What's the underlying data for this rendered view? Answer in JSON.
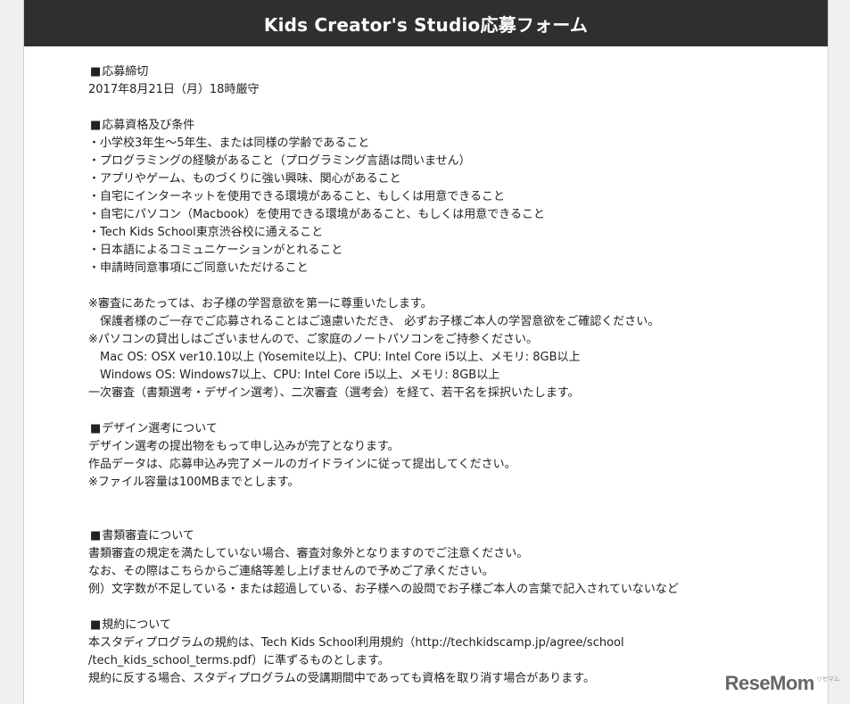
{
  "page": {
    "title": "Kids Creator's Studio応募フォーム"
  },
  "deadline": {
    "heading": "応募締切",
    "lines": [
      "2017年8月21日（月）18時厳守"
    ]
  },
  "eligibility": {
    "heading": "応募資格及び条件",
    "lines": [
      "・小学校3年生〜5年生、または同様の学齢であること",
      "・プログラミングの経験があること（プログラミング言語は問いません）",
      "・アプリやゲーム、ものづくりに強い興味、関心があること",
      "・自宅にインターネットを使用できる環境があること、もしくは用意できること",
      "・自宅にパソコン（Macbook）を使用できる環境があること、もしくは用意できること",
      "・Tech Kids School東京渋谷校に通えること",
      "・日本語によるコミュニケーションがとれること",
      "・申請時同意事項にご同意いただけること"
    ]
  },
  "notes": {
    "lines": [
      "※審査にあたっては、お子様の学習意欲を第一に尊重いたします。",
      "　保護者様のご一存でご応募されることはご遠慮いただき、 必ずお子様ご本人の学習意欲をご確認ください。",
      "※パソコンの貸出しはございませんので、ご家庭のノートパソコンをご持参ください。",
      "　Mac OS: OSX ver10.10以上 (Yosemite以上)、CPU: Intel Core i5以上、メモリ: 8GB以上",
      "　Windows OS: Windows7以上、CPU: Intel Core i5以上、メモリ: 8GB以上",
      "一次審査（書類選考・デザイン選考）、二次審査（選考会）を経て、若干名を採択いたします。"
    ]
  },
  "design": {
    "heading": "デザイン選考について",
    "lines": [
      "デザイン選考の提出物をもって申し込みが完了となります。",
      "作品データは、応募申込み完了メールのガイドラインに従って提出してください。",
      "※ファイル容量は100MBまでとします。"
    ]
  },
  "document_review": {
    "heading": "書類審査について",
    "lines": [
      "書類審査の規定を満たしていない場合、審査対象外となりますのでご注意ください。",
      "なお、その際はこちらからご連絡等差し上げませんので予めご了承ください。",
      "例）文字数が不足している・または超過している、お子様への設問でお子様ご本人の言葉で記入されていないなど"
    ]
  },
  "terms": {
    "heading": "規約について",
    "lines": [
      "本スタディプログラムの規約は、Tech Kids School利用規約（http://techkidscamp.jp/agree/school",
      "/tech_kids_school_terms.pdf）に準ずるものとします。",
      "規約に反する場合、スタディプログラムの受講期間中であっても資格を取り消す場合があります。"
    ]
  },
  "watermark": {
    "text": "ReseMom",
    "small": "リセマム"
  }
}
